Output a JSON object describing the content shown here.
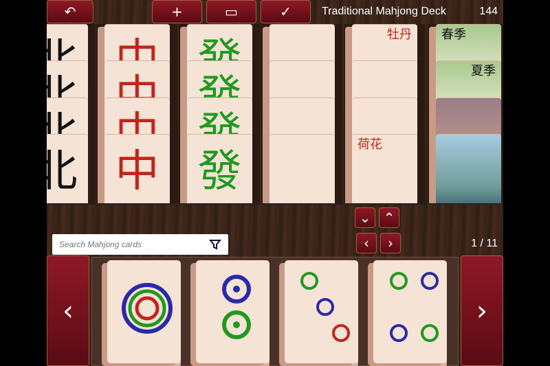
{
  "header": {
    "back_icon": "undo-arrow-icon",
    "add_icon": "plus-icon",
    "folder_icon": "folder-icon",
    "confirm_icon": "check-icon",
    "title": "Traditional Mahjong Deck",
    "count": "144"
  },
  "grid": {
    "columns": [
      {
        "tiles": [
          "北",
          "北",
          "北",
          "北"
        ],
        "color": "#111"
      },
      {
        "tiles": [
          "中",
          "中",
          "中",
          "中"
        ],
        "color": "#c0251b"
      },
      {
        "tiles": [
          "發",
          "發",
          "發",
          "發"
        ],
        "color": "#1e9a1e"
      },
      {
        "tiles": [
          "",
          "",
          "",
          ""
        ],
        "color": "#000"
      },
      {
        "tiles": [
          "牡丹",
          "",
          "",
          "荷花"
        ],
        "color": "#c0251b"
      },
      {
        "tiles": [
          "春季",
          "夏季",
          "",
          ""
        ],
        "color": "#111"
      }
    ]
  },
  "nav": {
    "down": "⌄",
    "up": "⌃",
    "prev": "‹",
    "next": "›"
  },
  "search": {
    "placeholder": "Search Mahjong cards",
    "filter_icon": "filter-icon"
  },
  "pager": "1 / 11",
  "tray": {
    "prev": "‹",
    "next": "›",
    "tiles": [
      "1 circle",
      "2 circles",
      "3 circles",
      "4 circles"
    ]
  },
  "colors": {
    "red": "#c0251b",
    "blue": "#2a2aa8",
    "green": "#1e9a1e",
    "button": "#7a1220"
  }
}
